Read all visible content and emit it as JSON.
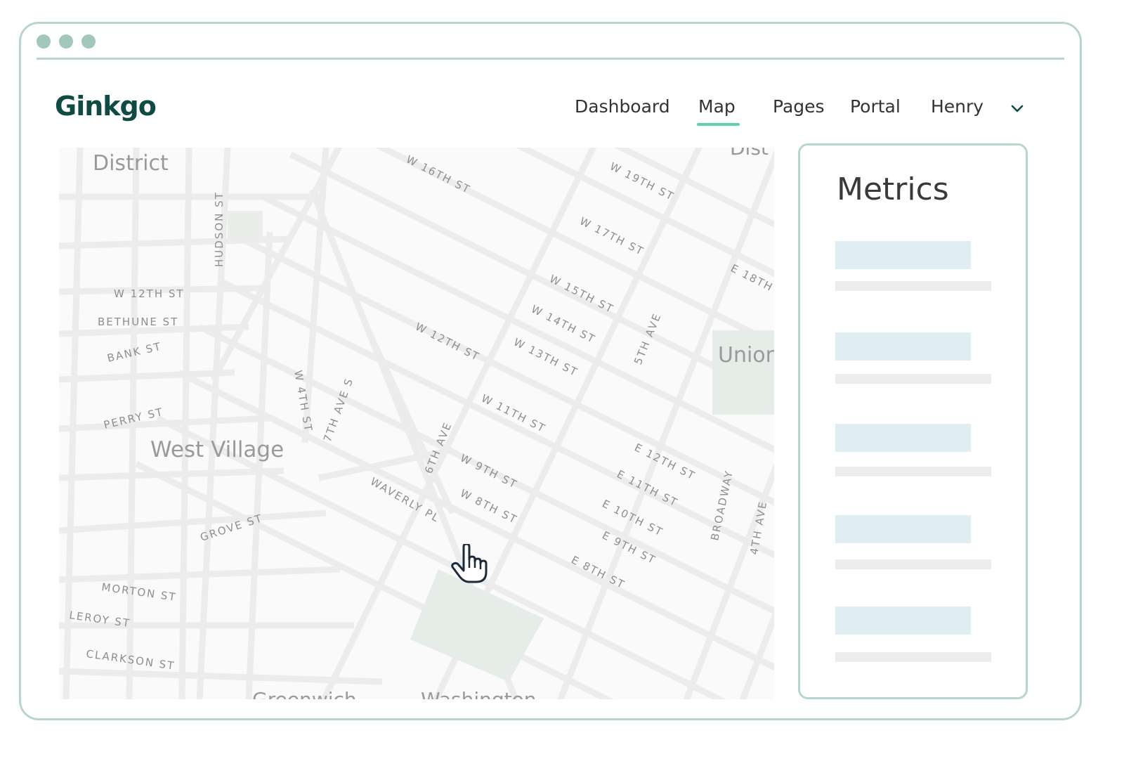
{
  "app": {
    "logo": "Ginkgo"
  },
  "nav": {
    "items": [
      {
        "label": "Dashboard",
        "active": false
      },
      {
        "label": "Map",
        "active": true
      },
      {
        "label": "Pages",
        "active": false
      },
      {
        "label": "Portal",
        "active": false
      }
    ],
    "user": "Henry"
  },
  "colors": {
    "accent": "#5fd1a6",
    "brand": "#0f4a43",
    "frame": "#b9d6cc",
    "skeleton_block": "#e0edf3"
  },
  "map": {
    "areas": [
      "District",
      "West Village",
      "Union Square",
      "Greenwich",
      "Washington",
      "Dist"
    ],
    "streets": [
      "W 16TH ST",
      "W 19TH ST",
      "W 17TH ST",
      "E 18TH",
      "W 15TH ST",
      "W 14TH ST",
      "W 13TH ST",
      "W 12TH ST",
      "W 11TH ST",
      "W 9TH ST",
      "W 8TH ST",
      "WAVERLY PL",
      "E 12TH ST",
      "E 11TH ST",
      "E 10TH ST",
      "E 9TH ST",
      "E 8TH ST",
      "HUDSON ST",
      "W 12TH ST",
      "BETHUNE ST",
      "BANK ST",
      "PERRY ST",
      "GROVE ST",
      "MORTON ST",
      "LEROY ST",
      "CLARKSON ST",
      "W 4TH ST",
      "7TH AVE S",
      "6TH AVE",
      "5TH AVE",
      "BROADWAY",
      "4TH AVE"
    ]
  },
  "metrics": {
    "title": "Metrics",
    "placeholder_rows": 5
  },
  "icons": {
    "user_menu": "chevron-down-icon",
    "cursor": "hand-pointer-icon"
  }
}
